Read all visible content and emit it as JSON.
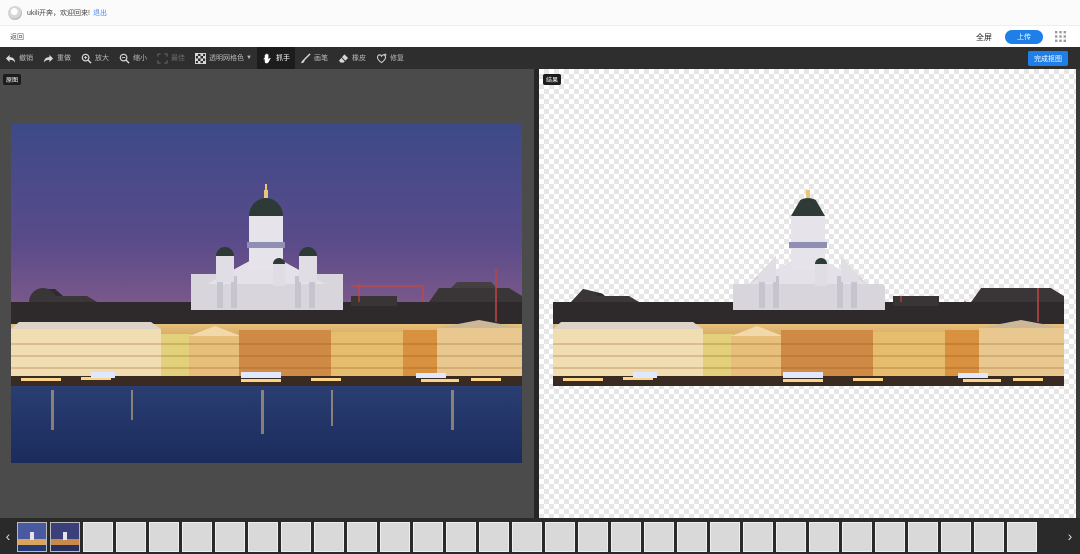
{
  "userbar": {
    "greeting": "ukili开奔，欢迎回来!",
    "logout": "退出"
  },
  "header": {
    "back": "返回",
    "fullscreen": "全屏",
    "upload": "上传",
    "apps_icon": "grid-icon"
  },
  "toolbar": {
    "items": [
      {
        "label": "撤销",
        "icon": "undo-icon",
        "state": "normal"
      },
      {
        "label": "重做",
        "icon": "redo-icon",
        "state": "normal"
      },
      {
        "label": "放大",
        "icon": "zoom-in-icon",
        "state": "normal"
      },
      {
        "label": "缩小",
        "icon": "zoom-out-icon",
        "state": "normal"
      },
      {
        "label": "最佳",
        "icon": "fit-icon",
        "state": "disabled"
      },
      {
        "label": "透明网格色",
        "icon": "checker-icon",
        "state": "normal",
        "dropdown": true
      },
      {
        "label": "抓手",
        "icon": "hand-icon",
        "state": "active"
      },
      {
        "label": "画笔",
        "icon": "brush-icon",
        "state": "normal"
      },
      {
        "label": "橡皮",
        "icon": "eraser-icon",
        "state": "normal"
      },
      {
        "label": "修复",
        "icon": "heal-icon",
        "state": "normal"
      }
    ],
    "done": "完成抠图"
  },
  "panels": {
    "original_tag": "原图",
    "result_tag": "结果"
  },
  "filmstrip": {
    "prev": "‹",
    "next": "›",
    "thumbnail_count": 31,
    "image_thumbnails": 2
  },
  "colors": {
    "accent": "#1e7fe8",
    "toolbar": "#2e2e2e",
    "canvas": "#4b4b4b"
  }
}
